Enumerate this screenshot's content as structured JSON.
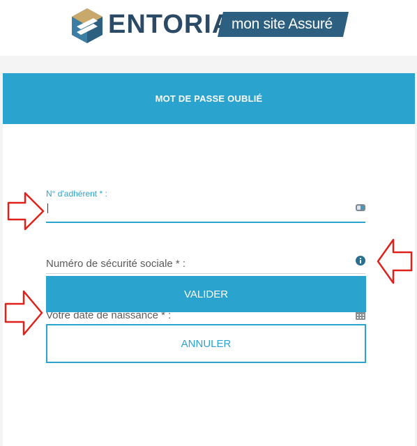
{
  "header": {
    "brand_name": "ENTORIA",
    "tagline": "mon site Assuré",
    "logo_icon": "entoria-hexagon-logo",
    "brand_color": "#2a4a66",
    "tagline_bg": "#2c5f80"
  },
  "card": {
    "title": "MOT DE PASSE OUBLIÉ",
    "accent_color": "#2aa3cf"
  },
  "form": {
    "member_number": {
      "label": "N° d'adhérent * :",
      "value": "",
      "icon": "id-card-icon"
    },
    "social_security": {
      "placeholder": "Numéro de sécurité sociale * :",
      "icon": "info-icon"
    },
    "birth_date": {
      "placeholder": "Votre date de naissance * :",
      "icon": "calendar-icon"
    }
  },
  "buttons": {
    "submit": "VALIDER",
    "cancel": "ANNULER"
  },
  "annotations": {
    "arrow_color": "#e0211b",
    "arrow_icon": "red-outline-arrow-icon"
  }
}
